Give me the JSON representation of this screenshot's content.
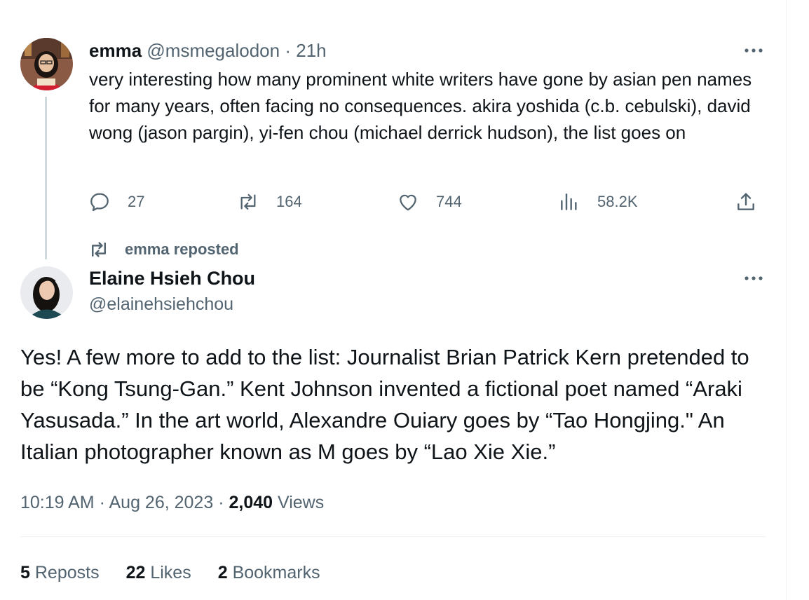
{
  "tweet1": {
    "name": "emma",
    "handle": "@msmegalodon",
    "time_sep": "·",
    "time": "21h",
    "text": "very interesting how many prominent white writers have gone by asian pen names for many years, often facing no consequences. akira yoshida (c.b. cebulski), david wong (jason pargin), yi-fen chou (michael derrick hudson), the list goes on",
    "actions": {
      "replies": "27",
      "reposts": "164",
      "likes": "744",
      "views": "58.2K"
    }
  },
  "repost_label": "emma reposted",
  "tweet2": {
    "name": "Elaine Hsieh Chou",
    "handle": "@elainehsiehchou",
    "text": "Yes! A few more to add to the list: Journalist Brian Patrick Kern pretended to be “Kong Tsung-Gan.” Kent Johnson invented a fictional poet named “Araki Yasusada.” In the art world, Alexandre Ouiary goes by “Tao Hongjing.\" An Italian photographer known as M goes by “Lao Xie Xie.”",
    "time": "10:19 AM",
    "date": "Aug 26, 2023",
    "sep": "·",
    "views_count": "2,040",
    "views_label": "Views",
    "stats": {
      "reposts_count": "5",
      "reposts_label": "Reposts",
      "likes_count": "22",
      "likes_label": "Likes",
      "bookmarks_count": "2",
      "bookmarks_label": "Bookmarks"
    }
  },
  "icons": {
    "more": "more-horizontal-icon",
    "reply": "reply-icon",
    "repost": "repost-icon",
    "like": "heart-icon",
    "views": "views-bar-icon",
    "share": "share-icon"
  },
  "colors": {
    "text": "#0f1419",
    "muted": "#536471",
    "thread_line": "#cfd9de",
    "divider": "#eff3f4"
  }
}
